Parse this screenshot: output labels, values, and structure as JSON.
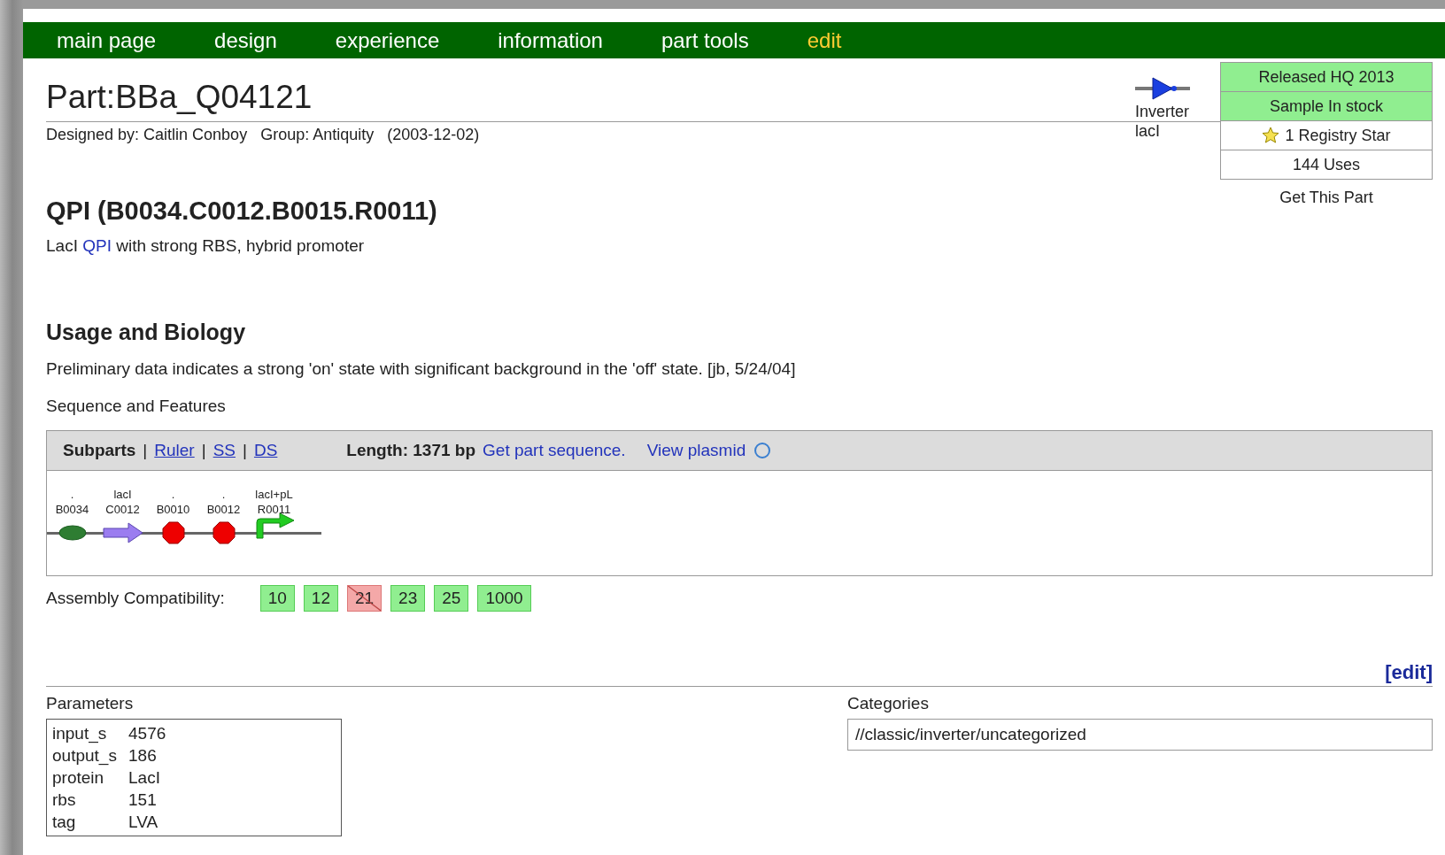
{
  "nav": [
    {
      "label": "main page",
      "selected": false
    },
    {
      "label": "design",
      "selected": false
    },
    {
      "label": "experience",
      "selected": false
    },
    {
      "label": "information",
      "selected": false
    },
    {
      "label": "part tools",
      "selected": false
    },
    {
      "label": "edit",
      "selected": true
    }
  ],
  "title": "Part:BBa_Q04121",
  "designer": "Designed by: Caitlin Conboy   Group: Antiquity   (2003-12-02)",
  "device": {
    "label": "Inverter",
    "sublabel": "lacI"
  },
  "status": [
    {
      "text": "Released HQ 2013",
      "color": "#90ee90"
    },
    {
      "text": "Sample In stock",
      "color": "#90ee90"
    },
    {
      "text": "1 Registry Star",
      "color": "#ffffff",
      "kind": "star"
    },
    {
      "text": "144 Uses",
      "color": "#ffffff"
    }
  ],
  "get_part": "Get This Part",
  "heading": "QPI (B0034.C0012.B0015.R0011)",
  "description": {
    "before": "LacI ",
    "link": "QPI",
    "after": " with strong RBS, hybrid promoter"
  },
  "usage_heading": "Usage and Biology",
  "usage_text": "Preliminary data indicates a strong 'on' state with significant background in the 'off' state. [jb, 5/24/04]",
  "sequence_label": "Sequence and Features",
  "sequence": {
    "views": [
      {
        "label": "Subparts",
        "selected": true
      },
      {
        "label": "Ruler",
        "selected": false
      },
      {
        "label": "SS",
        "selected": false
      },
      {
        "label": "DS",
        "selected": false
      }
    ],
    "separator": "|",
    "length": "Length: 1371 bp",
    "get_sequence": "Get part sequence.",
    "view_plasmid": "View plasmid",
    "subparts": [
      {
        "top": ".",
        "name": "B0034",
        "kind": "rbs"
      },
      {
        "top": "lacI",
        "name": "C0012",
        "kind": "cds"
      },
      {
        "top": ".",
        "name": "B0010",
        "kind": "terminator"
      },
      {
        "top": ".",
        "name": "B0012",
        "kind": "terminator"
      },
      {
        "top": "lacI+pL",
        "name": "R0011",
        "kind": "promoter"
      }
    ]
  },
  "assembly": {
    "label": "Assembly Compatibility:",
    "standards": [
      {
        "label": "10",
        "compatible": true
      },
      {
        "label": "12",
        "compatible": true
      },
      {
        "label": "21",
        "compatible": false
      },
      {
        "label": "23",
        "compatible": true
      },
      {
        "label": "25",
        "compatible": true
      },
      {
        "label": "1000",
        "compatible": true
      }
    ]
  },
  "edit_link": "[edit]",
  "parameters": {
    "title": "Parameters",
    "rows": [
      {
        "name": "input_s",
        "value": "4576"
      },
      {
        "name": "output_s",
        "value": "186"
      },
      {
        "name": "protein",
        "value": "LacI"
      },
      {
        "name": "rbs",
        "value": "151"
      },
      {
        "name": "tag",
        "value": "LVA"
      }
    ]
  },
  "categories": {
    "title": "Categories",
    "value": "//classic/inverter/uncategorized"
  }
}
